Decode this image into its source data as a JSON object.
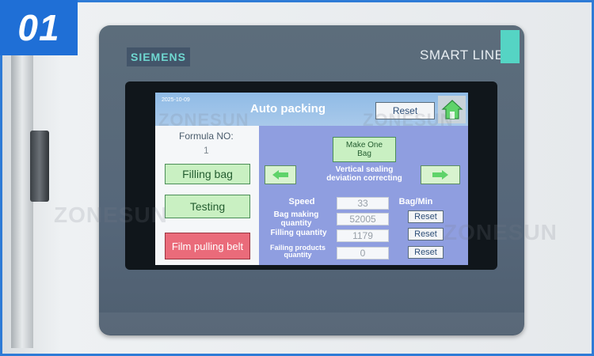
{
  "badge": "01",
  "device": {
    "brand": "SIEMENS",
    "model": "SMART LINE"
  },
  "screen": {
    "timestamp": "2025-10-09",
    "title": "Auto packing",
    "reset_top": "Reset",
    "home_icon": "home-icon",
    "formula_label": "Formula NO:",
    "formula_value": "1",
    "buttons": {
      "filling_bag": "Filling bag",
      "testing": "Testing",
      "film_pulling_belt": "Film pulling belt",
      "make_one_bag": "Make One Bag"
    },
    "vertical_sealing": "Vertical sealing deviation correcting",
    "rows": [
      {
        "label": "Speed",
        "value": "33",
        "unit": "Bag/Min"
      },
      {
        "label": "Bag making quantity",
        "value": "52005",
        "reset": "Reset"
      },
      {
        "label": "Filling quantity",
        "value": "1179",
        "reset": "Reset"
      },
      {
        "label": "Failing products quantity",
        "value": "0",
        "reset": "Reset"
      }
    ]
  },
  "watermark": "ZONESUN",
  "colors": {
    "badge": "#1f6fd6",
    "accent_panel": "#8f9ee0",
    "green_button": "#c9f0c2",
    "red_button": "#ea6b7a"
  }
}
